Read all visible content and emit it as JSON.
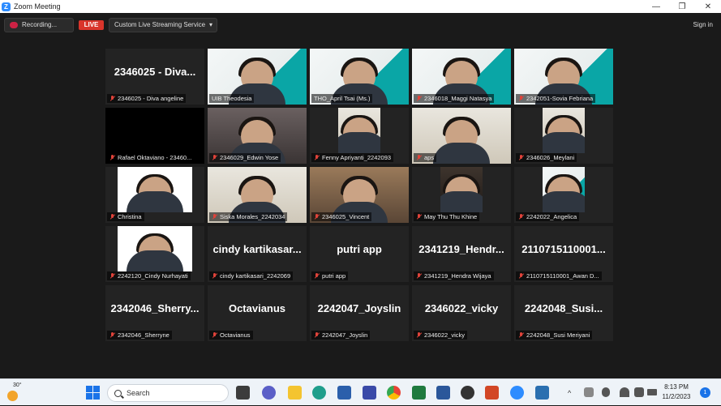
{
  "window": {
    "title": "Zoom Meeting",
    "logo_letter": "Z",
    "controls": {
      "minimize": "—",
      "maximize": "❐",
      "close": "✕"
    }
  },
  "toolbar": {
    "recording_label": "Recording...",
    "live_label": "LIVE",
    "stream_service": "Custom Live Streaming Service",
    "stream_chevron": "▾",
    "signin_label": "Sign in"
  },
  "tiles": [
    {
      "big": "2346025 - Diva...",
      "name": "2346025 - Diva angeline",
      "kind": "name",
      "muted": true
    },
    {
      "big": "",
      "name": "UIB Theodesia",
      "kind": "slide",
      "muted": false,
      "active": true
    },
    {
      "big": "",
      "name": "THO_April Tsai (Ms.)",
      "kind": "slide",
      "muted": false
    },
    {
      "big": "",
      "name": "2346018_Maggi Natasya",
      "kind": "slide",
      "muted": true
    },
    {
      "big": "",
      "name": "2342051-Sovia Febriana",
      "kind": "slide",
      "muted": true
    },
    {
      "big": "",
      "name": "Rafael Oktaviano - 23460...",
      "kind": "black",
      "muted": true
    },
    {
      "big": "",
      "name": "2346029_Edwin Yose",
      "kind": "room",
      "muted": true
    },
    {
      "big": "",
      "name": "Fenny Apriyanti_2242093",
      "kind": "wall-inset",
      "muted": true
    },
    {
      "big": "",
      "name": "aps",
      "kind": "wall",
      "muted": true
    },
    {
      "big": "",
      "name": "2346026_Meylani",
      "kind": "wall-inset",
      "muted": true
    },
    {
      "big": "",
      "name": "Christina",
      "kind": "white-inset",
      "muted": true
    },
    {
      "big": "",
      "name": "Siska Morales_2242034",
      "kind": "wall",
      "muted": true
    },
    {
      "big": "",
      "name": "2346025_Vincent",
      "kind": "warm",
      "muted": true
    },
    {
      "big": "",
      "name": "May Thu Thu Khine",
      "kind": "dark-inset",
      "muted": true
    },
    {
      "big": "",
      "name": "2242022_Angelica",
      "kind": "slide-inset",
      "muted": true
    },
    {
      "big": "",
      "name": "2242120_Cindy Nurhayati",
      "kind": "white-inset",
      "muted": true
    },
    {
      "big": "cindy kartikasar...",
      "name": "cindy kartikasari_2242069",
      "kind": "name",
      "muted": true
    },
    {
      "big": "putri app",
      "name": "putri app",
      "kind": "name",
      "muted": true
    },
    {
      "big": "2341219_Hendr...",
      "name": "2341219_Hendra Wijaya",
      "kind": "name",
      "muted": true
    },
    {
      "big": "2110715110001...",
      "name": "2110715110001_Awan D...",
      "kind": "name",
      "muted": true
    },
    {
      "big": "2342046_Sherry...",
      "name": "2342046_Sherryne",
      "kind": "name",
      "muted": true
    },
    {
      "big": "Octavianus",
      "name": "Octavianus",
      "kind": "name",
      "muted": true
    },
    {
      "big": "2242047_Joyslin",
      "name": "2242047_Joyslin",
      "kind": "name",
      "muted": true
    },
    {
      "big": "2346022_vicky",
      "name": "2346022_vicky",
      "kind": "name",
      "muted": true
    },
    {
      "big": "2242048_Susi...",
      "name": "2242048_Susi Meriyani",
      "kind": "name",
      "muted": true
    }
  ],
  "taskbar": {
    "temperature": "30°",
    "search_placeholder": "Search",
    "time": "8:13 PM",
    "date": "11/2/2023",
    "notification_count": "1",
    "tray_chevron": "^"
  }
}
